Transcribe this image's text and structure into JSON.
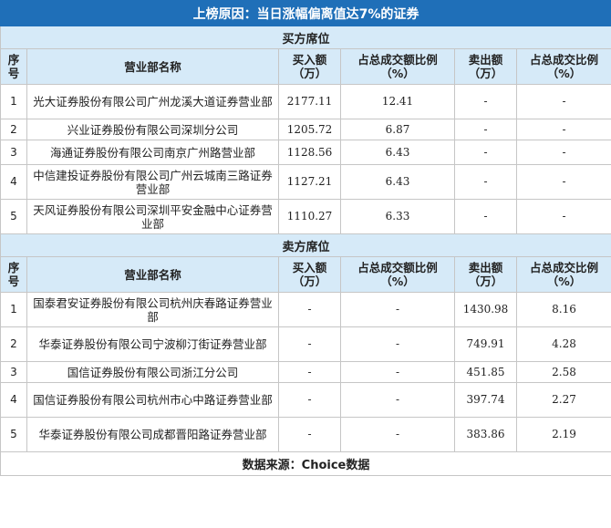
{
  "title": "上榜原因：当日涨幅偏离值达7%的证券",
  "columns": [
    "序号",
    "营业部名称",
    "买入额（万）",
    "占总成交额比例（%）",
    "卖出额（万）",
    "占总成交比例（%）"
  ],
  "buy": {
    "label": "买方席位",
    "rows": [
      {
        "no": "1",
        "name": "光大证券股份有限公司广州龙溪大道证券营业部",
        "buy": "2177.11",
        "buy_pct": "12.41",
        "sell": "-",
        "sell_pct": "-"
      },
      {
        "no": "2",
        "name": "兴业证券股份有限公司深圳分公司",
        "buy": "1205.72",
        "buy_pct": "6.87",
        "sell": "-",
        "sell_pct": "-"
      },
      {
        "no": "3",
        "name": "海通证券股份有限公司南京广州路营业部",
        "buy": "1128.56",
        "buy_pct": "6.43",
        "sell": "-",
        "sell_pct": "-"
      },
      {
        "no": "4",
        "name": "中信建投证券股份有限公司广州云城南三路证券营业部",
        "buy": "1127.21",
        "buy_pct": "6.43",
        "sell": "-",
        "sell_pct": "-"
      },
      {
        "no": "5",
        "name": "天风证券股份有限公司深圳平安金融中心证券营业部",
        "buy": "1110.27",
        "buy_pct": "6.33",
        "sell": "-",
        "sell_pct": "-"
      }
    ]
  },
  "sell": {
    "label": "卖方席位",
    "rows": [
      {
        "no": "1",
        "name": "国泰君安证券股份有限公司杭州庆春路证券营业部",
        "buy": "-",
        "buy_pct": "-",
        "sell": "1430.98",
        "sell_pct": "8.16"
      },
      {
        "no": "2",
        "name": "华泰证券股份有限公司宁波柳汀街证券营业部",
        "buy": "-",
        "buy_pct": "-",
        "sell": "749.91",
        "sell_pct": "4.28"
      },
      {
        "no": "3",
        "name": "国信证券股份有限公司浙江分公司",
        "buy": "-",
        "buy_pct": "-",
        "sell": "451.85",
        "sell_pct": "2.58"
      },
      {
        "no": "4",
        "name": "国信证券股份有限公司杭州市心中路证券营业部",
        "buy": "-",
        "buy_pct": "-",
        "sell": "397.74",
        "sell_pct": "2.27"
      },
      {
        "no": "5",
        "name": "华泰证券股份有限公司成都晋阳路证券营业部",
        "buy": "-",
        "buy_pct": "-",
        "sell": "383.86",
        "sell_pct": "2.19"
      }
    ]
  },
  "footer": "数据来源：Choice数据"
}
